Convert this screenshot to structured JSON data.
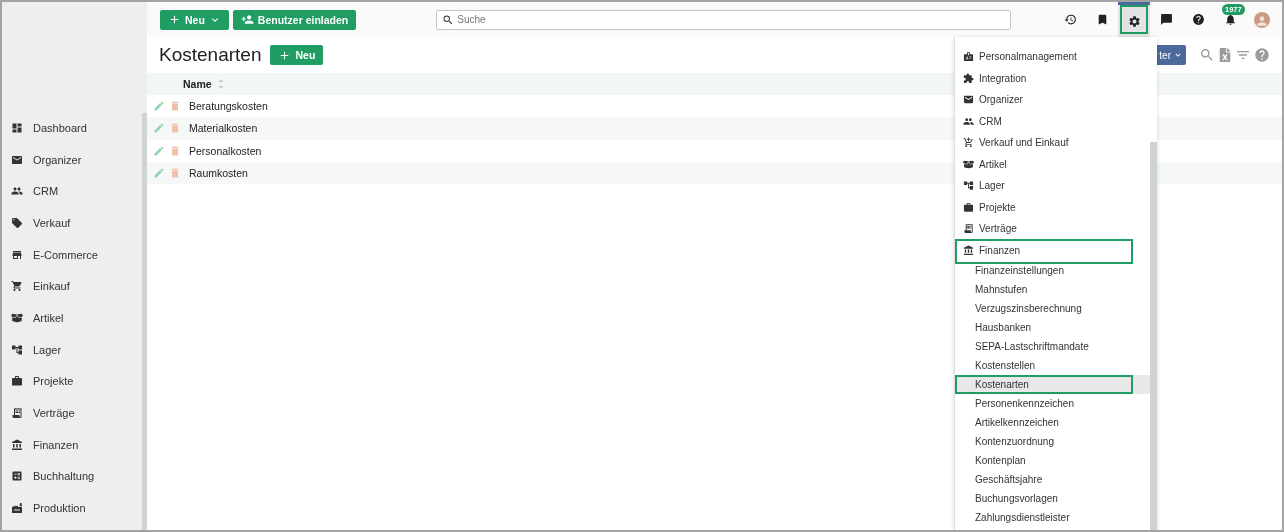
{
  "topbar": {
    "new_button": "Neu",
    "invite_button": "Benutzer einladen",
    "search": {
      "placeholder": "Suche"
    },
    "icons": [
      {
        "kind": "history",
        "selected": false,
        "highlighted": false
      },
      {
        "kind": "bookmark",
        "selected": false,
        "highlighted": false
      },
      {
        "kind": "settings",
        "selected": true,
        "highlighted": true
      },
      {
        "kind": "chat",
        "selected": false,
        "highlighted": false
      },
      {
        "kind": "help",
        "selected": false,
        "highlighted": false
      },
      {
        "kind": "notifications",
        "selected": false,
        "highlighted": false,
        "badge": "1977"
      },
      {
        "kind": "avatar",
        "selected": false,
        "highlighted": false
      }
    ]
  },
  "sidebar": {
    "items": [
      {
        "label": "Dashboard"
      },
      {
        "label": "Organizer"
      },
      {
        "label": "CRM"
      },
      {
        "label": "Verkauf"
      },
      {
        "label": "E-Commerce"
      },
      {
        "label": "Einkauf"
      },
      {
        "label": "Artikel"
      },
      {
        "label": "Lager"
      },
      {
        "label": "Projekte"
      },
      {
        "label": "Verträge"
      },
      {
        "label": "Finanzen"
      },
      {
        "label": "Buchhaltung"
      },
      {
        "label": "Produktion"
      }
    ]
  },
  "page": {
    "title": "Kostenarten",
    "new_button": "Neu",
    "partial_button": "ter"
  },
  "table": {
    "columns": [
      {
        "label": "Name",
        "sortable": true
      }
    ],
    "rows": [
      {
        "name": "Beratungskosten"
      },
      {
        "name": "Materialkosten"
      },
      {
        "name": "Personalkosten"
      },
      {
        "name": "Raumkosten"
      }
    ]
  },
  "settings_menu": {
    "items": [
      {
        "label": "Personalmanagement",
        "highlighted": false
      },
      {
        "label": "Integration",
        "highlighted": false
      },
      {
        "label": "Organizer",
        "highlighted": false
      },
      {
        "label": "CRM",
        "highlighted": false
      },
      {
        "label": "Verkauf und Einkauf",
        "highlighted": false
      },
      {
        "label": "Artikel",
        "highlighted": false
      },
      {
        "label": "Lager",
        "highlighted": false
      },
      {
        "label": "Projekte",
        "highlighted": false
      },
      {
        "label": "Verträge",
        "highlighted": false
      },
      {
        "label": "Finanzen",
        "highlighted": true,
        "children": [
          {
            "label": "Finanzeinstellungen",
            "selected": false,
            "highlighted": false
          },
          {
            "label": "Mahnstufen",
            "selected": false,
            "highlighted": false
          },
          {
            "label": "Verzugszinsberechnung",
            "selected": false,
            "highlighted": false
          },
          {
            "label": "Hausbanken",
            "selected": false,
            "highlighted": false
          },
          {
            "label": "SEPA-Lastschriftmandate",
            "selected": false,
            "highlighted": false
          },
          {
            "label": "Kostenstellen",
            "selected": false,
            "highlighted": false
          },
          {
            "label": "Kostenarten",
            "selected": true,
            "highlighted": true
          },
          {
            "label": "Personenkennzeichen",
            "selected": false,
            "highlighted": false
          },
          {
            "label": "Artikelkennzeichen",
            "selected": false,
            "highlighted": false
          },
          {
            "label": "Kontenzuordnung",
            "selected": false,
            "highlighted": false
          },
          {
            "label": "Kontenplan",
            "selected": false,
            "highlighted": false
          },
          {
            "label": "Geschäftsjahre",
            "selected": false,
            "highlighted": false
          },
          {
            "label": "Buchungsvorlagen",
            "selected": false,
            "highlighted": false
          },
          {
            "label": "Zahlungsdienstleister",
            "selected": false,
            "highlighted": false
          }
        ]
      }
    ]
  }
}
